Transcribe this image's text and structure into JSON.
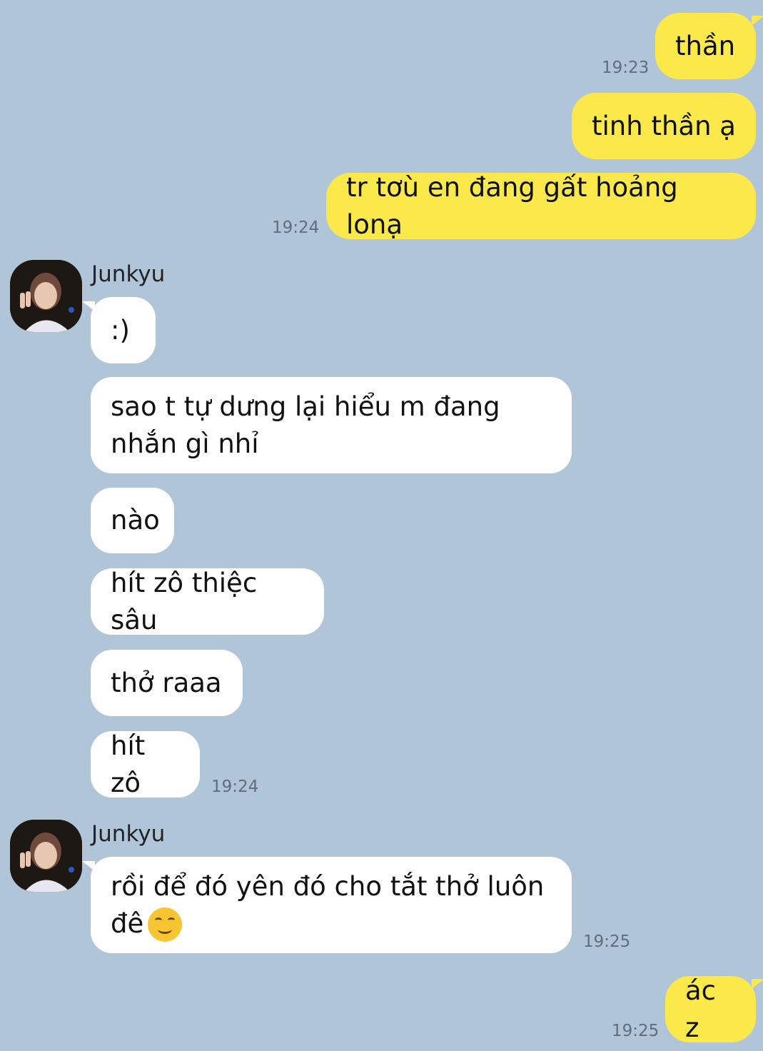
{
  "contact": {
    "name": "Junkyu"
  },
  "messages_out_1": [
    {
      "text": "thần"
    },
    {
      "text": "tinh thần ạ"
    },
    {
      "text": "tr tơù en đang gất hoảng lonạ"
    }
  ],
  "times": {
    "t1": "19:23",
    "t2": "19:24",
    "t3": "19:24",
    "t4": "19:25",
    "t5": "19:25"
  },
  "messages_in_1": [
    {
      "text": ":)"
    },
    {
      "text": "sao t tự dưng lại hiểu m đang\nnhắn gì nhỉ"
    },
    {
      "text": "nào"
    },
    {
      "text": "hít zô thiệc sâu"
    },
    {
      "text": "thở raaa"
    },
    {
      "text": "hít zô"
    }
  ],
  "messages_in_2": [
    {
      "text": "rồi để đó yên đó cho tắt thở luôn\nđê",
      "emoji": "smiling-hugging-face-emoji"
    }
  ],
  "messages_out_2": [
    {
      "text": "ác z"
    }
  ],
  "colors": {
    "background": "#b1c5d9",
    "outgoing_bubble": "#fbe84a",
    "incoming_bubble": "#ffffff",
    "timestamp": "#5f6d7c"
  }
}
